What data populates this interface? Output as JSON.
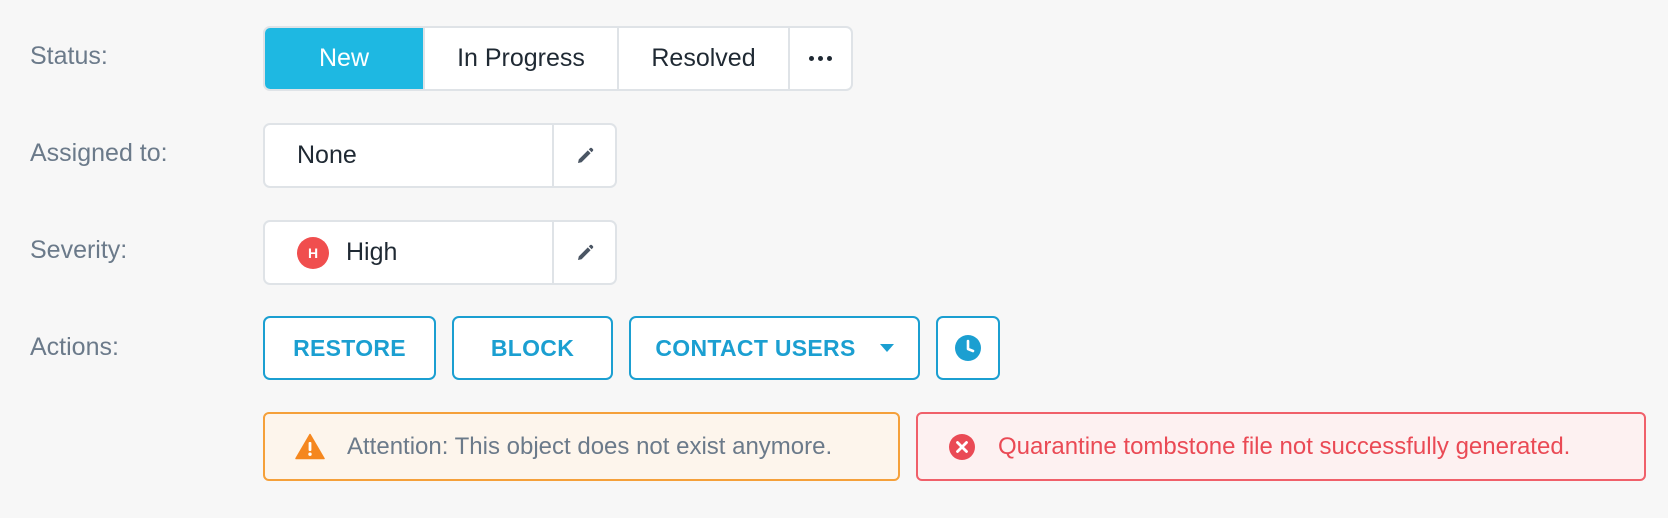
{
  "status": {
    "label": "Status:",
    "options": [
      "New",
      "In Progress",
      "Resolved"
    ],
    "active": "New",
    "more_icon": "more-horizontal-icon"
  },
  "assigned": {
    "label": "Assigned to:",
    "value": "None",
    "edit_icon": "pencil-icon"
  },
  "severity": {
    "label": "Severity:",
    "badge": "H",
    "value": "High",
    "badge_color": "#f04e4e",
    "edit_icon": "pencil-icon"
  },
  "actions": {
    "label": "Actions:",
    "restore": "RESTORE",
    "block": "BLOCK",
    "contact": "CONTACT USERS",
    "schedule_icon": "clock-icon"
  },
  "alerts": {
    "warning": "Attention: This object does not exist anymore.",
    "error": "Quarantine tombstone file not successfully generated."
  },
  "colors": {
    "accent": "#1eb8e2",
    "action": "#1b9fd1",
    "warning": "#f5a03a",
    "error": "#ea4a55"
  }
}
